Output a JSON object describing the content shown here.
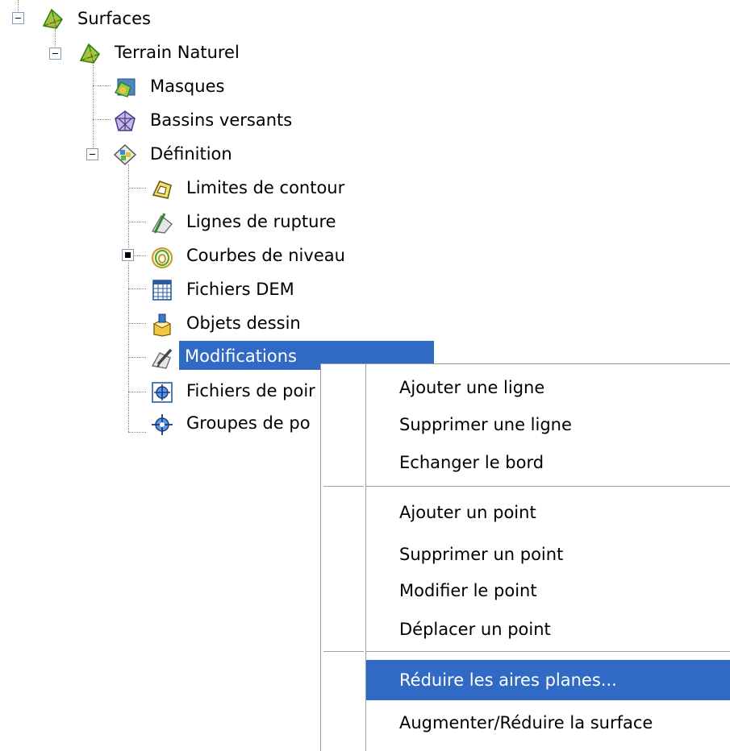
{
  "tree": {
    "surfaces": "Surfaces",
    "terrain": "Terrain Naturel",
    "masques": "Masques",
    "bassins": "Bassins versants",
    "definition": "Définition",
    "limites": "Limites de contour",
    "lignes": "Lignes de rupture",
    "courbes": "Courbes de niveau",
    "dem": "Fichiers DEM",
    "objets": "Objets dessin",
    "modifications": "Modifications",
    "fichiers_points": "Fichiers de poir",
    "groupes_points": "Groupes de po"
  },
  "menu": {
    "items": [
      "Ajouter une ligne",
      "Supprimer une ligne",
      "Echanger le bord",
      "Ajouter un point",
      "Supprimer un point",
      "Modifier le point",
      "Déplacer un point",
      "Réduire les aires planes...",
      "Augmenter/Réduire la surface"
    ],
    "highlighted_index": 7
  },
  "colors": {
    "selection": "#316ac5",
    "tree_lines": "#8a8a8a"
  }
}
